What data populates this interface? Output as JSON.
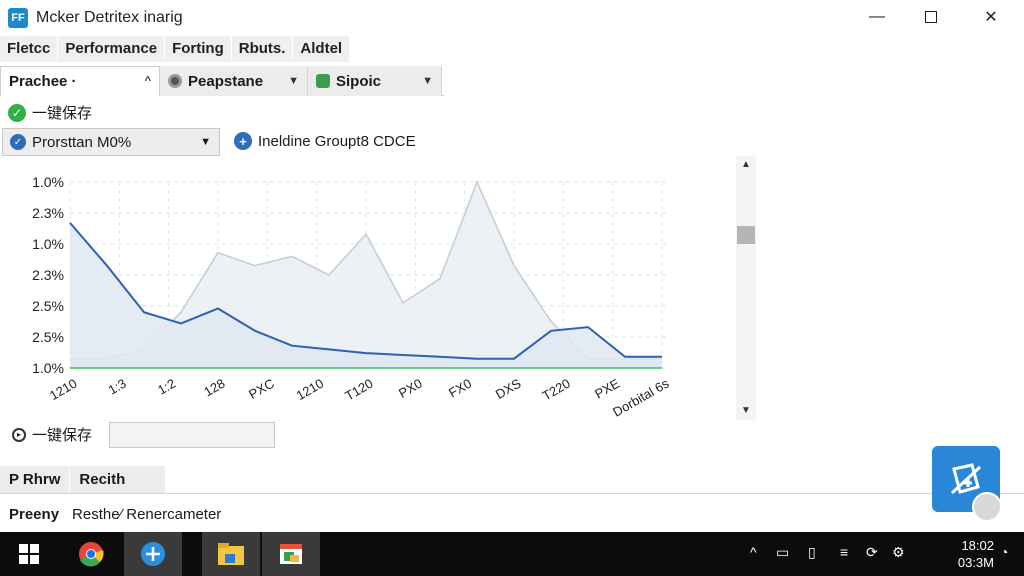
{
  "window": {
    "title": "Mcker Detritex inarig",
    "app_icon_text": "FF",
    "minimize_glyph": "—",
    "close_glyph": "✕"
  },
  "menu": [
    "Fletcc",
    "Performance",
    "Forting",
    "Rbuts.",
    "Aldtel"
  ],
  "tabs": [
    {
      "label": "Prachee ·",
      "caret": "^"
    },
    {
      "label": "Peapstane",
      "caret": "▼"
    },
    {
      "label": "Sipoic",
      "caret": "▼"
    }
  ],
  "status": {
    "label": "一键保存",
    "icon": "check-icon"
  },
  "select": {
    "value": "Prorsttan M0%",
    "caret": "▼"
  },
  "info": {
    "label": "Ineldine Groupt8 CDCE",
    "icon_glyph": "+"
  },
  "chart_data": {
    "type": "area",
    "y_tick_labels": [
      "1.0%",
      "2.3%",
      "1.0%",
      "2.3%",
      "2.5%",
      "2.5%",
      "1.0%"
    ],
    "x_tick_labels": [
      "1210",
      "1:3",
      "1:2",
      "128",
      "PXC",
      "1210",
      "T120",
      "PX0",
      "FX0",
      "DXS",
      "T220",
      "PXE",
      "Dorbital 6s"
    ],
    "grid": true,
    "series": [
      {
        "color": "#2f5fb3",
        "fill": "#dfe8f1",
        "values": [
          0.78,
          0.55,
          0.3,
          0.24,
          0.32,
          0.2,
          0.12,
          0.1,
          0.08,
          0.07,
          0.06,
          0.05,
          0.05,
          0.2,
          0.22,
          0.06,
          0.06
        ]
      },
      {
        "color": "#c7ced6",
        "fill": "#e9eef3",
        "values": [
          0.05,
          0.05,
          0.1,
          0.3,
          0.62,
          0.55,
          0.6,
          0.5,
          0.72,
          0.35,
          0.48,
          1.0,
          0.55,
          0.25,
          0.05,
          0.05,
          0.05
        ]
      },
      {
        "color": "#3cc45a",
        "values": [
          0.0,
          0.0,
          0.0,
          0.0,
          0.0,
          0.0,
          0.0,
          0.0,
          0.0,
          0.0,
          0.0,
          0.0,
          0.0,
          0.0,
          0.0,
          0.0,
          0.0
        ]
      }
    ]
  },
  "scroll": {
    "up": "▲",
    "down": "▼"
  },
  "save_row": {
    "label": "一键保存",
    "input_value": ""
  },
  "table": {
    "headers": [
      "P Rhrw",
      "Recith"
    ],
    "rows": [
      [
        "Preeny",
        "Resthe⁄ Renercameter"
      ]
    ]
  },
  "clock": {
    "time": "18:02",
    "date": "03:3M"
  },
  "colors": {
    "accent": "#2a86d6",
    "line": "#2f5fb3",
    "green": "#3cc45a"
  }
}
